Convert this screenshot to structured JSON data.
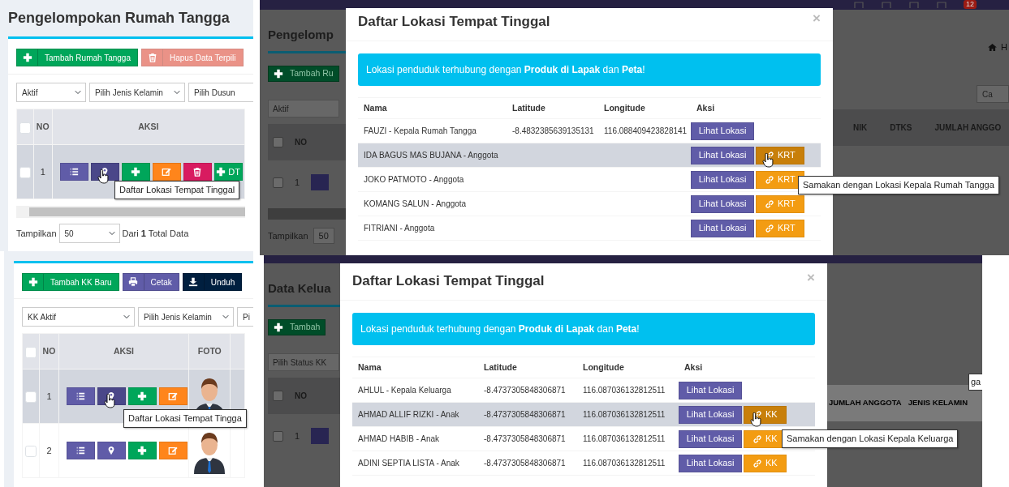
{
  "household_panel": {
    "title": "Pengelompokan Rumah Tangga",
    "buttons": [
      {
        "kind": "add",
        "label": "Tambah Rumah Tangga",
        "disabled": false
      },
      {
        "kind": "delete",
        "label": "Hapus Data Terpili",
        "disabled": true
      }
    ],
    "filters": [
      "Aktif",
      "Pilih Jenis Kelamin",
      "Pilih Dusun"
    ],
    "select_all": {
      "checked": false
    },
    "columns": [
      "NO",
      "AKSI"
    ],
    "rows": [
      {
        "checked": false,
        "no": "1",
        "hovered": true,
        "actions": [
          {
            "kind": "list",
            "hovered": false
          },
          {
            "kind": "location",
            "hovered": true
          },
          {
            "kind": "add",
            "hovered": false
          },
          {
            "kind": "edit",
            "hovered": false
          },
          {
            "kind": "delete",
            "hovered": false
          },
          {
            "kind": "add",
            "label": "DT",
            "hovered": false
          }
        ]
      }
    ],
    "tooltip": "Daftar Lokasi Tempat Tinggal",
    "footer": {
      "label": "Tampilkan",
      "page_size": "50",
      "summary": "Dari **1** Total Data"
    }
  },
  "family_panel": {
    "buttons": [
      {
        "kind": "add",
        "label": "Tambah KK Baru",
        "disabled": false
      },
      {
        "kind": "print",
        "label": "Cetak",
        "disabled": false
      },
      {
        "kind": "download",
        "label": "Unduh",
        "disabled": false
      }
    ],
    "filters": [
      "KK Aktif",
      "Pilih Jenis Kelamin",
      "Pi"
    ],
    "select_all": {
      "checked": false
    },
    "columns": [
      "NO",
      "AKSI",
      "FOTO"
    ],
    "rows": [
      {
        "checked": false,
        "no": "1",
        "hovered": true,
        "actions": [
          {
            "kind": "list",
            "hovered": false
          },
          {
            "kind": "location",
            "hovered": true
          },
          {
            "kind": "add",
            "hovered": false
          },
          {
            "kind": "edit",
            "hovered": false
          }
        ]
      },
      {
        "checked": false,
        "no": "2",
        "hovered": false,
        "actions": [
          {
            "kind": "list",
            "hovered": false
          },
          {
            "kind": "location",
            "hovered": false
          },
          {
            "kind": "add",
            "hovered": false
          },
          {
            "kind": "edit",
            "hovered": false
          }
        ]
      }
    ],
    "tooltip": "Daftar Lokasi Tempat Tingga"
  },
  "household_backdrop": {
    "notification_count": "12",
    "title": "Pengelomp",
    "breadcrumb": "H",
    "add_button": "Tambah Ru",
    "filter": "Aktif",
    "search_placeholder": "Ca",
    "header_checked": false,
    "left_columns": [
      "NO"
    ],
    "right_columns": [
      "NIK",
      "DTKS",
      "JUMLAH ANGGO"
    ],
    "row_checked": false,
    "row_no": "1",
    "footer_label": "Tampilkan",
    "page_size": "50"
  },
  "household_location_modal": {
    "title": "Daftar Lokasi Tempat Tinggal",
    "close_label": "×",
    "alert": "Lokasi penduduk terhubung dengan **Produk di Lapak** dan **Peta**!",
    "columns": [
      "Nama",
      "Latitude",
      "Longitude",
      "Aksi"
    ],
    "rows": [
      {
        "name": "FAUZI - Kepala Rumah Tangga",
        "latitude": "-8.4832385639135131",
        "longitude": "116.088409423828141",
        "hovered": false,
        "view_label": "Lihat Lokasi"
      },
      {
        "name": "IDA BAGUS MAS BUJANA - Anggota",
        "hovered": true,
        "view_label": "Lihat Lokasi",
        "link_label": "KRT"
      },
      {
        "name": "JOKO PATMOTO - Anggota",
        "hovered": false,
        "view_label": "Lihat Lokasi",
        "link_label": "KRT"
      },
      {
        "name": "KOMANG SALUN - Anggota",
        "hovered": false,
        "view_label": "Lihat Lokasi",
        "link_label": "KRT"
      },
      {
        "name": "FITRIANI - Anggota",
        "hovered": false,
        "view_label": "Lihat Lokasi",
        "link_label": "KRT"
      }
    ],
    "tooltip": "Samakan dengan Lokasi Kepala Rumah Tangga"
  },
  "family_backdrop": {
    "title": "Data Kelua",
    "add_button": "Tambah",
    "filter": "Pilih Status KK",
    "header_checked": false,
    "left_columns": [
      "NO"
    ],
    "right_columns": [
      "JUMLAH ANGGOTA",
      "JENIS KELAMIN"
    ],
    "row_checked": false,
    "row_no": "1",
    "tooltip_fragment": "ga"
  },
  "family_location_modal": {
    "title": "Daftar Lokasi Tempat Tinggal",
    "close_label": "×",
    "alert": "Lokasi penduduk terhubung dengan **Produk di Lapak** dan **Peta**!",
    "columns": [
      "Nama",
      "Latitude",
      "Longitude",
      "Aksi"
    ],
    "rows": [
      {
        "name": "AHLUL - Kepala Keluarga",
        "latitude": "-8.4737305848306871",
        "longitude": "116.087036132812511",
        "hovered": false,
        "view_label": "Lihat Lokasi"
      },
      {
        "name": "AHMAD ALLIF RIZKI - Anak",
        "latitude": "-8.4737305848306871",
        "longitude": "116.087036132812511",
        "hovered": true,
        "view_label": "Lihat Lokasi",
        "link_label": "KK"
      },
      {
        "name": "AHMAD HABIB - Anak",
        "latitude": "-8.4737305848306871",
        "longitude": "116.087036132812511",
        "hovered": false,
        "view_label": "Lihat Lokasi",
        "link_label": "KK"
      },
      {
        "name": "ADINI SEPTIA LISTA - Anak",
        "latitude": "-8.4737305848306871",
        "longitude": "116.087036132812511",
        "hovered": false,
        "view_label": "Lihat Lokasi",
        "link_label": "KK"
      }
    ],
    "tooltip": "Samakan dengan Lokasi Kepala Keluarga"
  }
}
